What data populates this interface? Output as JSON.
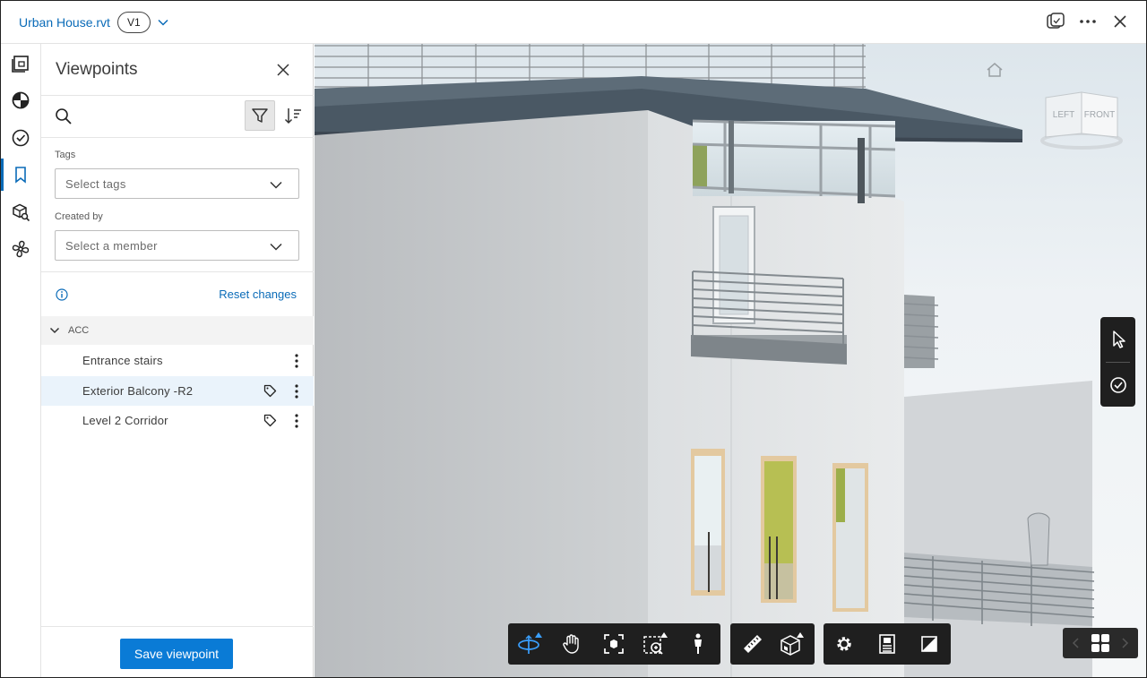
{
  "header": {
    "file_name": "Urban House.rvt",
    "version": "V1"
  },
  "panel": {
    "title": "Viewpoints",
    "tags_label": "Tags",
    "tags_placeholder": "Select tags",
    "created_by_label": "Created by",
    "created_by_placeholder": "Select a member",
    "reset_label": "Reset changes",
    "group_label": "ACC",
    "viewpoints": [
      {
        "label": "Entrance stairs",
        "tagged": false,
        "selected": false
      },
      {
        "label": "Exterior Balcony -R2",
        "tagged": true,
        "selected": true
      },
      {
        "label": "Level 2 Corridor",
        "tagged": true,
        "selected": false
      }
    ],
    "save_label": "Save viewpoint"
  },
  "viewcube": {
    "left_label": "LEFT",
    "front_label": "FRONT"
  },
  "colors": {
    "accent": "#0a6bb8",
    "primary_button": "#0a7bd6",
    "toolbar_bg": "#1f1f1f",
    "active_tool": "#3aa0ff"
  },
  "icons": {
    "rail": [
      "sheets-icon",
      "model-browser-icon",
      "issues-icon",
      "viewpoints-icon",
      "explode-search-icon",
      "fan-icon"
    ],
    "toolbar": [
      "orbit-icon",
      "pan-icon",
      "fit-view-icon",
      "zoom-window-icon",
      "first-person-icon",
      "measure-icon",
      "section-box-icon",
      "settings-icon",
      "properties-icon",
      "fullscreen-icon"
    ]
  }
}
